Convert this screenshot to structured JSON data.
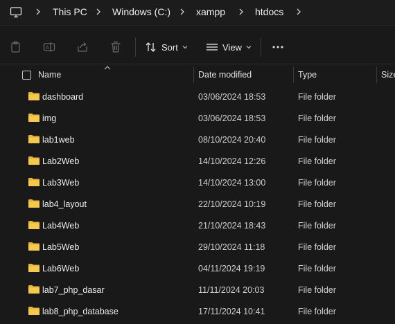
{
  "breadcrumb": {
    "items": [
      "This PC",
      "Windows (C:)",
      "xampp",
      "htdocs"
    ]
  },
  "toolbar": {
    "sort_label": "Sort",
    "view_label": "View"
  },
  "columns": {
    "name": "Name",
    "date_modified": "Date modified",
    "type": "Type",
    "size": "Size"
  },
  "files": [
    {
      "name": "dashboard",
      "date": "03/06/2024 18:53",
      "type": "File folder"
    },
    {
      "name": "img",
      "date": "03/06/2024 18:53",
      "type": "File folder"
    },
    {
      "name": "lab1web",
      "date": "08/10/2024 20:40",
      "type": "File folder"
    },
    {
      "name": "Lab2Web",
      "date": "14/10/2024 12:26",
      "type": "File folder"
    },
    {
      "name": "Lab3Web",
      "date": "14/10/2024 13:00",
      "type": "File folder"
    },
    {
      "name": "lab4_layout",
      "date": "22/10/2024 10:19",
      "type": "File folder"
    },
    {
      "name": "Lab4Web",
      "date": "21/10/2024 18:43",
      "type": "File folder"
    },
    {
      "name": "Lab5Web",
      "date": "29/10/2024 11:18",
      "type": "File folder"
    },
    {
      "name": "Lab6Web",
      "date": "04/11/2024 19:19",
      "type": "File folder"
    },
    {
      "name": "lab7_php_dasar",
      "date": "11/11/2024 20:03",
      "type": "File folder"
    },
    {
      "name": "lab8_php_database",
      "date": "17/11/2024 10:41",
      "type": "File folder"
    }
  ],
  "colors": {
    "background": "#191919",
    "folder": "#f5c94a",
    "text": "#e6e6e6"
  }
}
